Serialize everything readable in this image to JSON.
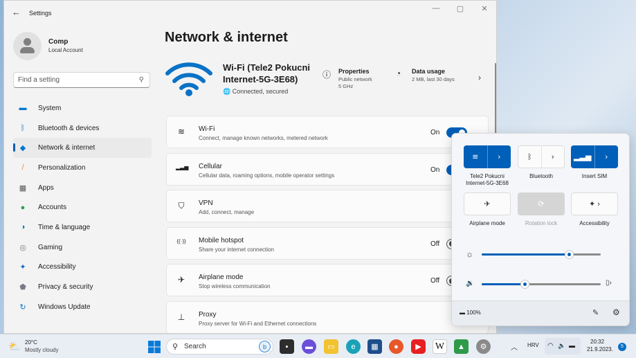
{
  "window": {
    "title": "Settings",
    "controls": {
      "minimize": "—",
      "maximize": "▢",
      "close": "✕"
    }
  },
  "account": {
    "name": "Comp",
    "type": "Local Account"
  },
  "search": {
    "placeholder": "Find a setting"
  },
  "sidebar": {
    "items": [
      {
        "label": "System",
        "icon": "system-icon",
        "color": "#0078d4"
      },
      {
        "label": "Bluetooth & devices",
        "icon": "bluetooth-icon",
        "color": "#0078d4"
      },
      {
        "label": "Network & internet",
        "icon": "network-icon",
        "color": "#0078d4",
        "active": true
      },
      {
        "label": "Personalization",
        "icon": "brush-icon",
        "color": "#e08a3c"
      },
      {
        "label": "Apps",
        "icon": "apps-icon",
        "color": "#555555"
      },
      {
        "label": "Accounts",
        "icon": "accounts-icon",
        "color": "#2a9d55"
      },
      {
        "label": "Time & language",
        "icon": "globe-clock-icon",
        "color": "#0a7ac2"
      },
      {
        "label": "Gaming",
        "icon": "gamepad-icon",
        "color": "#7a7a7a"
      },
      {
        "label": "Accessibility",
        "icon": "accessibility-icon",
        "color": "#1a66c2"
      },
      {
        "label": "Privacy & security",
        "icon": "shield-icon",
        "color": "#7a7a8a"
      },
      {
        "label": "Windows Update",
        "icon": "update-icon",
        "color": "#0a6fc2"
      }
    ]
  },
  "main": {
    "title": "Network & internet",
    "hero": {
      "network_name": "Wi-Fi (Tele2 Pokucni Internet-5G-3E68)",
      "status": "Connected, secured",
      "properties": {
        "title": "Properties",
        "line1": "Public network",
        "line2": "5 GHz"
      },
      "usage": {
        "title": "Data usage",
        "line1": "2 MB, last 30 days"
      }
    },
    "rows": [
      {
        "title": "Wi-Fi",
        "sub": "Connect, manage known networks, metered network",
        "state": "On",
        "toggle": "on",
        "icon": "wifi-icon"
      },
      {
        "title": "Cellular",
        "sub": "Cellular data, roaming options, mobile operator settings",
        "state": "On",
        "toggle": "on",
        "icon": "cellular-icon"
      },
      {
        "title": "VPN",
        "sub": "Add, connect, manage",
        "state": "",
        "toggle": "",
        "icon": "vpn-shield-icon"
      },
      {
        "title": "Mobile hotspot",
        "sub": "Share your internet connection",
        "state": "Off",
        "toggle": "off",
        "icon": "hotspot-icon"
      },
      {
        "title": "Airplane mode",
        "sub": "Stop wireless communication",
        "state": "Off",
        "toggle": "off",
        "icon": "airplane-icon"
      },
      {
        "title": "Proxy",
        "sub": "Proxy server for Wi-Fi and Ethernet connections",
        "state": "",
        "toggle": "",
        "icon": "proxy-icon"
      }
    ]
  },
  "quick_settings": {
    "tiles": [
      {
        "label": "Tele2 Pokucni Internet-5G-3E68",
        "state": "on",
        "icon": "wifi-icon"
      },
      {
        "label": "Bluetooth",
        "state": "off",
        "icon": "bluetooth-icon"
      },
      {
        "label": "Insert SIM",
        "state": "on",
        "icon": "cellular-icon"
      },
      {
        "label": "Airplane mode",
        "state": "off",
        "icon": "airplane-icon"
      },
      {
        "label": "Rotation lock",
        "state": "disabled",
        "icon": "rotation-lock-icon"
      },
      {
        "label": "Accessibility",
        "state": "off",
        "icon": "accessibility-icon"
      }
    ],
    "brightness_level": 0.73,
    "volume_level": 0.36,
    "battery": "100%"
  },
  "taskbar": {
    "weather": {
      "temp": "20°C",
      "desc": "Mostly cloudy"
    },
    "search_placeholder": "Search",
    "tray": {
      "language": "HRV",
      "time": "20:32",
      "date": "21.9.2023.",
      "notifications": "5"
    }
  },
  "colors": {
    "accent": "#005fb8"
  }
}
